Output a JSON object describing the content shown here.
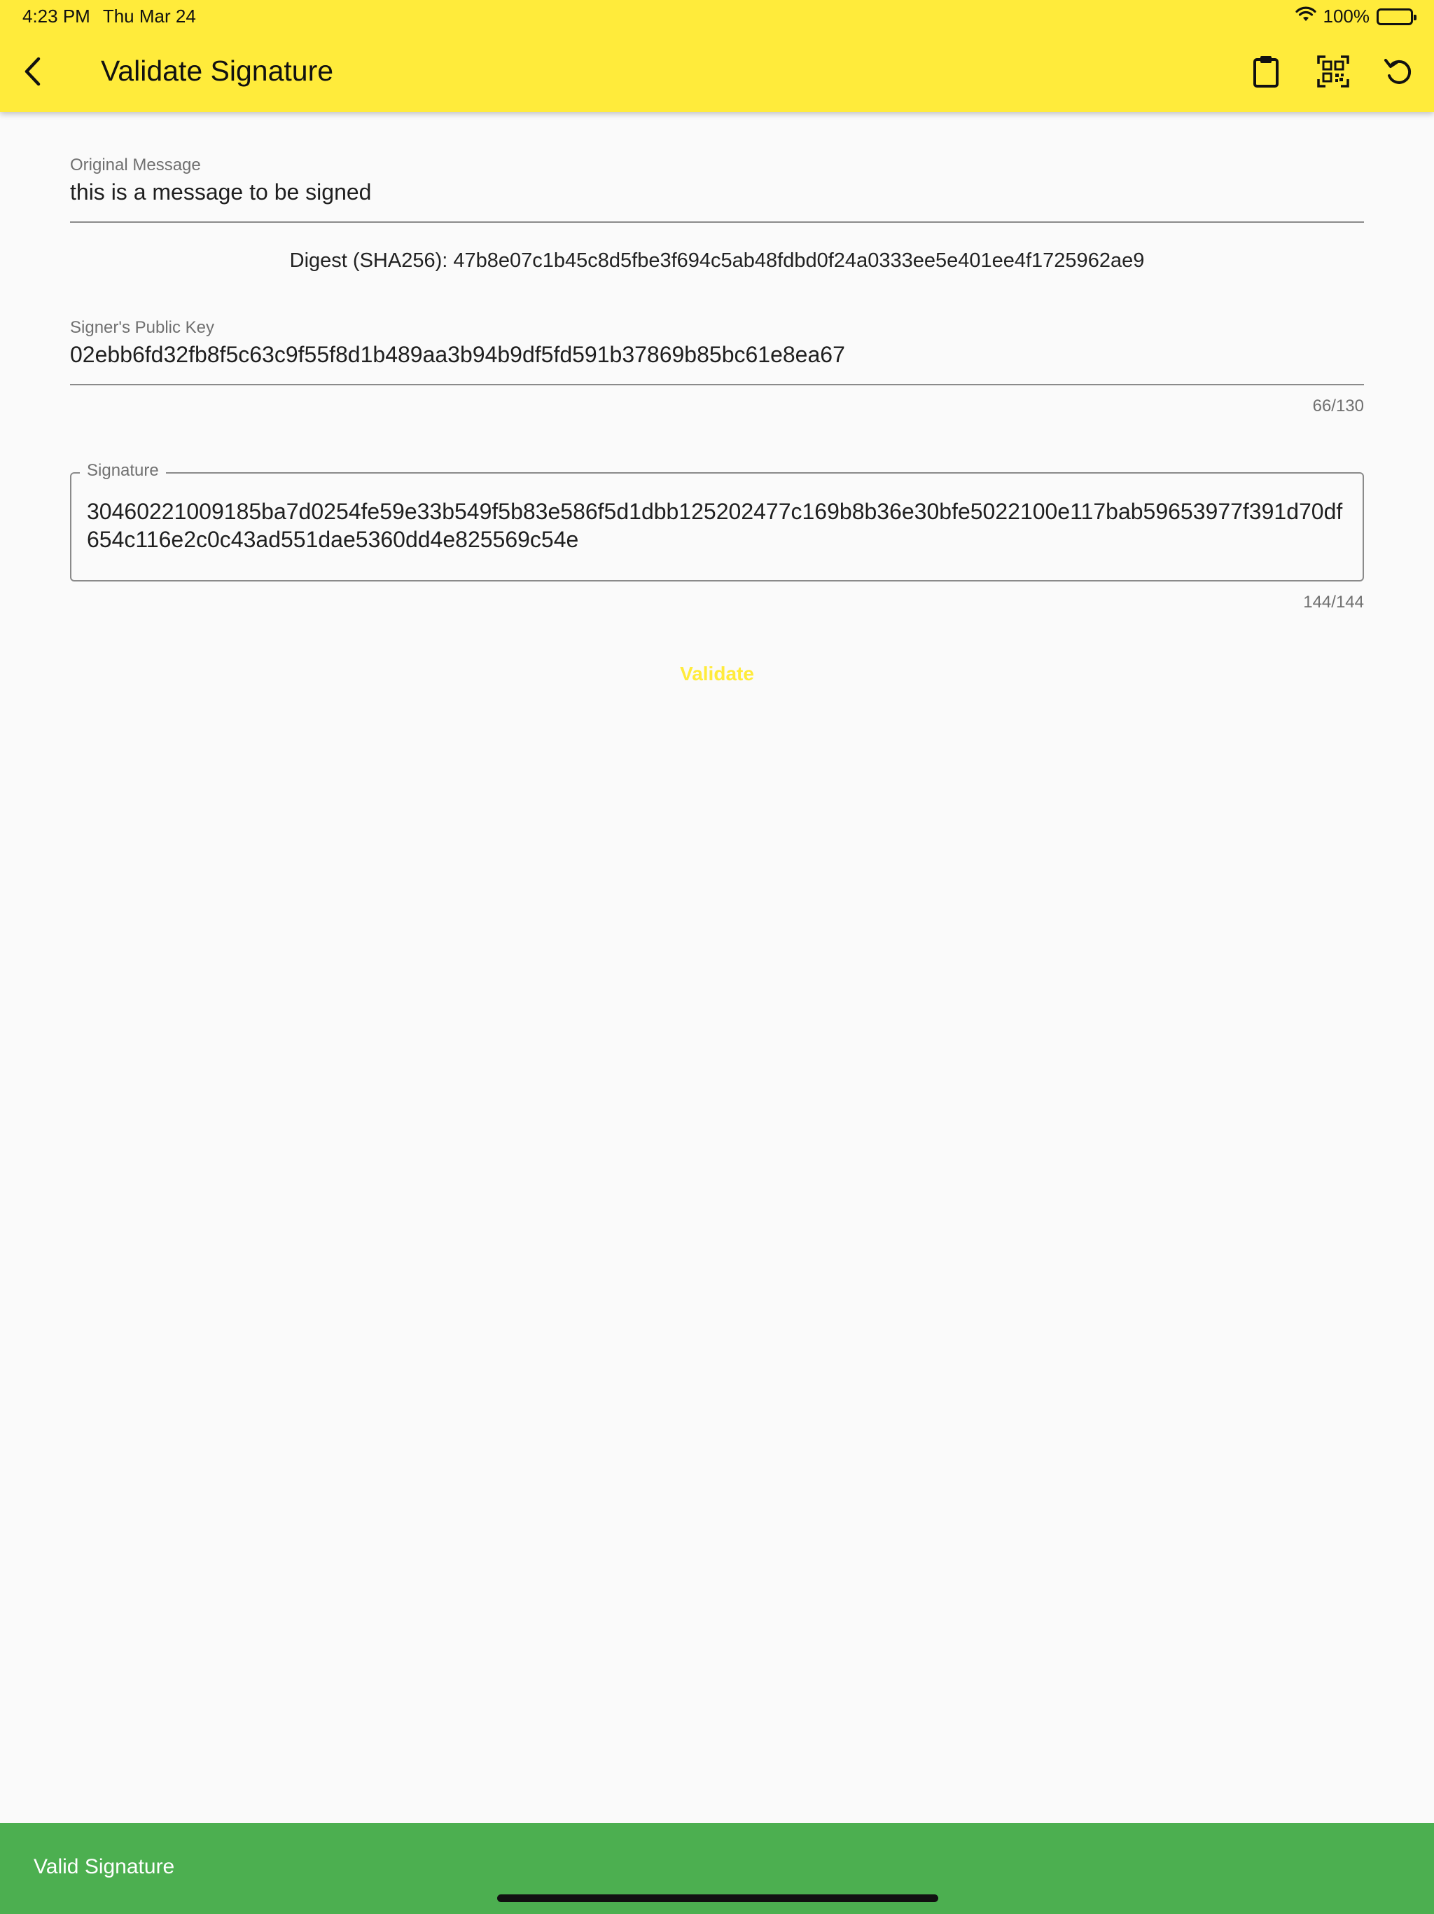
{
  "status_bar": {
    "time": "4:23 PM",
    "date": "Thu Mar 24",
    "battery": "100%"
  },
  "app_bar": {
    "title": "Validate Signature",
    "icons": [
      "chevron-left-icon",
      "clipboard-icon",
      "qr-scan-icon",
      "refresh-icon"
    ],
    "background": "#ffeb3b"
  },
  "form": {
    "original_message": {
      "label": "Original Message",
      "value": "this is a message to be signed"
    },
    "digest": "Digest (SHA256): 47b8e07c1b45c8d5fbe3f694c5ab48fdbd0f24a0333ee5e401ee4f1725962ae9",
    "public_key": {
      "label": "Signer's Public Key",
      "value": "02ebb6fd32fb8f5c63c9f55f8d1b489aa3b94b9df5fd591b37869b85bc61e8ea67",
      "counter": "66/130"
    },
    "signature": {
      "label": "Signature",
      "value": "30460221009185ba7d0254fe59e33b549f5b83e586f5d1dbb125202477c169b8b36e30bfe5022100e117bab59653977f391d70df654c116e2c0c43ad551dae5360dd4e825569c54e",
      "counter": "144/144"
    },
    "validate_label": "Validate"
  },
  "snackbar": {
    "message": "Valid Signature",
    "color": "#4caf50"
  }
}
